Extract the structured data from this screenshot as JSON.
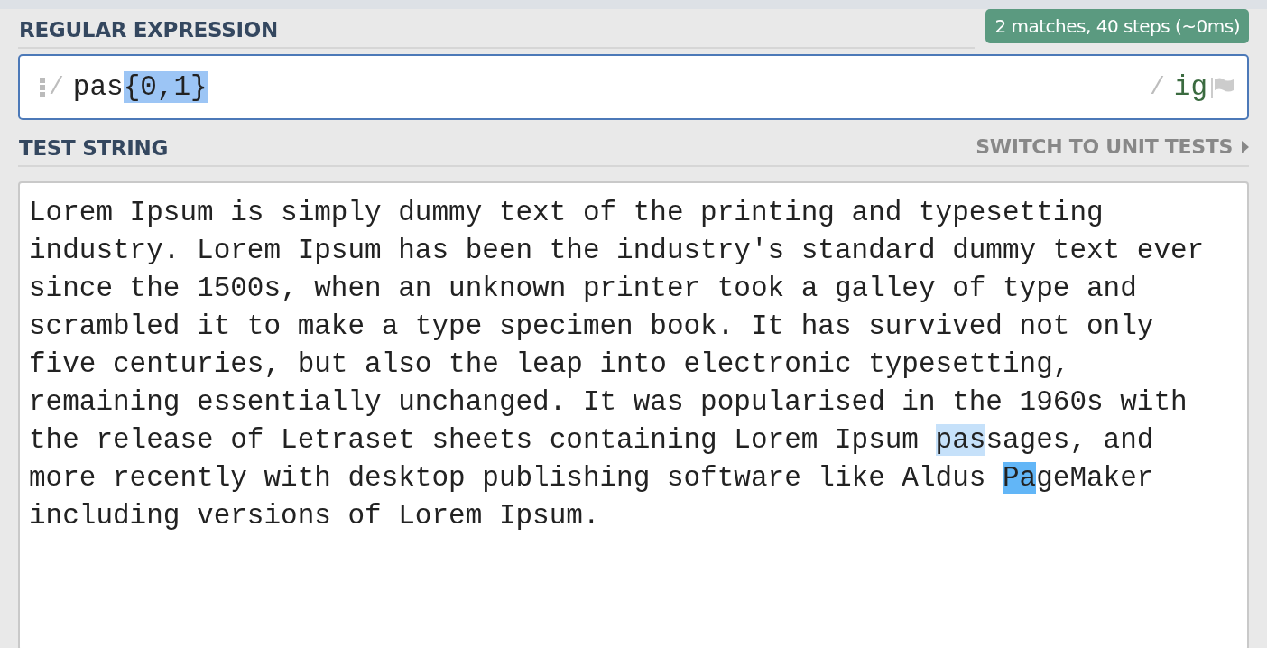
{
  "regex_section": {
    "title": "REGULAR EXPRESSION",
    "status": "2 matches, 40 steps (~0ms)",
    "field": {
      "open_delimiter": "/",
      "tokens": [
        {
          "text": "pas",
          "kind": "literal"
        },
        {
          "text": "{0,1}",
          "kind": "quantifier"
        }
      ],
      "close_delimiter": "/",
      "flags": "ig"
    }
  },
  "test_section": {
    "title": "TEST STRING",
    "switch_link": "SWITCH TO UNIT TESTS",
    "lines": [
      [
        {
          "text": "Lorem Ipsum is simply dummy text of the printing and typesetting",
          "kind": "plain"
        }
      ],
      [
        {
          "text": "industry. Lorem Ipsum has been the industry's standard dummy text ever",
          "kind": "plain"
        }
      ],
      [
        {
          "text": "since the 1500s, when an unknown printer took a galley of type and",
          "kind": "plain"
        }
      ],
      [
        {
          "text": "scrambled it to make a type specimen book. It has survived not only",
          "kind": "plain"
        }
      ],
      [
        {
          "text": "five centuries, but also the leap into electronic typesetting,",
          "kind": "plain"
        }
      ],
      [
        {
          "text": "remaining essentially unchanged. It was popularised in the 1960s with",
          "kind": "plain"
        }
      ],
      [
        {
          "text": "the release of Letraset sheets containing Lorem Ipsum ",
          "kind": "plain"
        },
        {
          "text": "pas",
          "kind": "match_light"
        },
        {
          "text": "sages, and",
          "kind": "plain"
        }
      ],
      [
        {
          "text": "more recently with desktop publishing software like Aldus ",
          "kind": "plain"
        },
        {
          "text": "Pa",
          "kind": "match_dark"
        },
        {
          "text": "geMaker",
          "kind": "plain"
        }
      ],
      [
        {
          "text": "including versions of Lorem Ipsum.",
          "kind": "plain"
        }
      ]
    ]
  }
}
